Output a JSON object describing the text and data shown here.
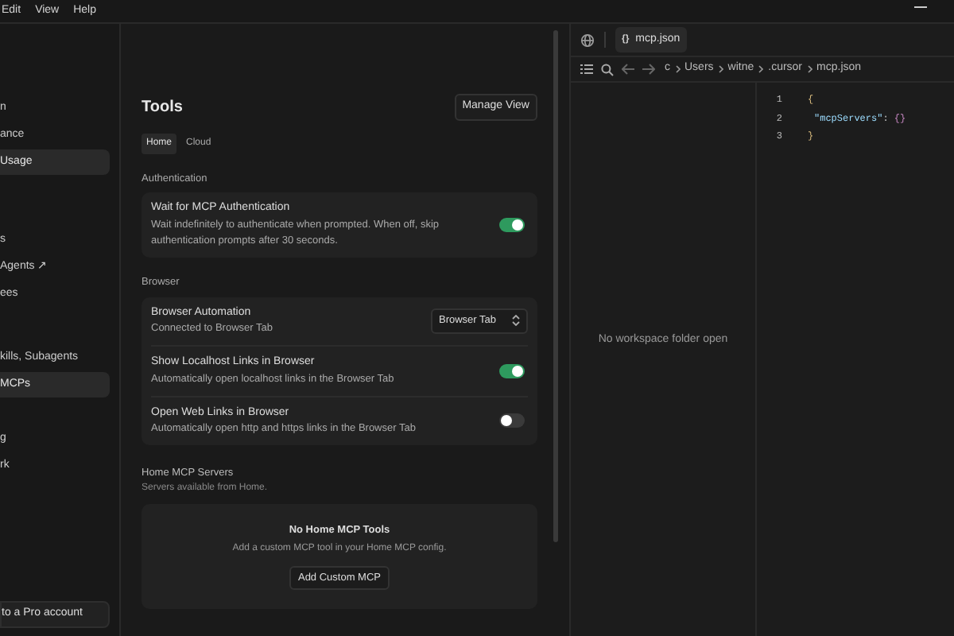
{
  "menu_bar": {
    "items": [
      "Edit",
      "View",
      "Help"
    ]
  },
  "sidebar": {
    "groups": [
      {
        "items": [
          {
            "label": "n",
            "selected": false
          },
          {
            "label": "ance",
            "selected": false
          },
          {
            "label": "Usage",
            "selected": true
          }
        ]
      },
      {
        "items": [
          {
            "label": "s",
            "selected": false
          },
          {
            "label": "Agents ↗",
            "selected": false
          },
          {
            "label": "ees",
            "selected": false
          }
        ]
      },
      {
        "items": [
          {
            "label": "kills, Subagents",
            "selected": false
          },
          {
            "label": "MCPs",
            "selected": true
          }
        ]
      },
      {
        "items": [
          {
            "label": "g",
            "selected": false
          },
          {
            "label": "rk",
            "selected": false
          }
        ]
      }
    ],
    "upgrade_button": "to a Pro account"
  },
  "settings": {
    "title": "Tools",
    "manage_button": "Manage View",
    "tabs": [
      {
        "label": "Home",
        "selected": true
      },
      {
        "label": "Cloud",
        "selected": false
      }
    ],
    "sections": [
      {
        "heading": "Authentication",
        "rows": [
          {
            "kind": "toggle",
            "title": "Wait for MCP Authentication",
            "description": "Wait indefinitely to authenticate when prompted. When off, skip authentication prompts after 30 seconds.",
            "on": true
          }
        ]
      },
      {
        "heading": "Browser",
        "rows": [
          {
            "kind": "select",
            "title": "Browser Automation",
            "description": "Connected to Browser Tab",
            "value": "Browser Tab"
          },
          {
            "kind": "toggle",
            "title": "Show Localhost Links in Browser",
            "description": "Automatically open localhost links in the Browser Tab",
            "on": true
          },
          {
            "kind": "toggle",
            "title": "Open Web Links in Browser",
            "description": "Automatically open http and https links in the Browser Tab",
            "on": false
          }
        ]
      }
    ],
    "servers": {
      "heading": "Home MCP Servers",
      "subheading": "Servers available from Home.",
      "empty_title": "No Home MCP Tools",
      "empty_text": "Add a custom MCP tool in your Home MCP config.",
      "add_button": "Add Custom MCP"
    }
  },
  "editor": {
    "tab": {
      "label": "mcp.json",
      "icon": "{}"
    },
    "breadcrumb": [
      "c",
      "Users",
      "witne",
      ".cursor",
      "mcp.json"
    ],
    "explorer_message": "No workspace folder open",
    "code_lines": [
      {
        "number": "1",
        "tokens": [
          {
            "kind": "brace",
            "text": "{"
          }
        ]
      },
      {
        "number": "2",
        "tokens": [
          {
            "kind": "key",
            "text": "\"mcpServers\""
          },
          {
            "kind": "punct",
            "text": ": "
          },
          {
            "kind": "object",
            "text": "{}"
          }
        ]
      },
      {
        "number": "3",
        "tokens": [
          {
            "kind": "brace",
            "text": "}"
          }
        ]
      }
    ]
  }
}
